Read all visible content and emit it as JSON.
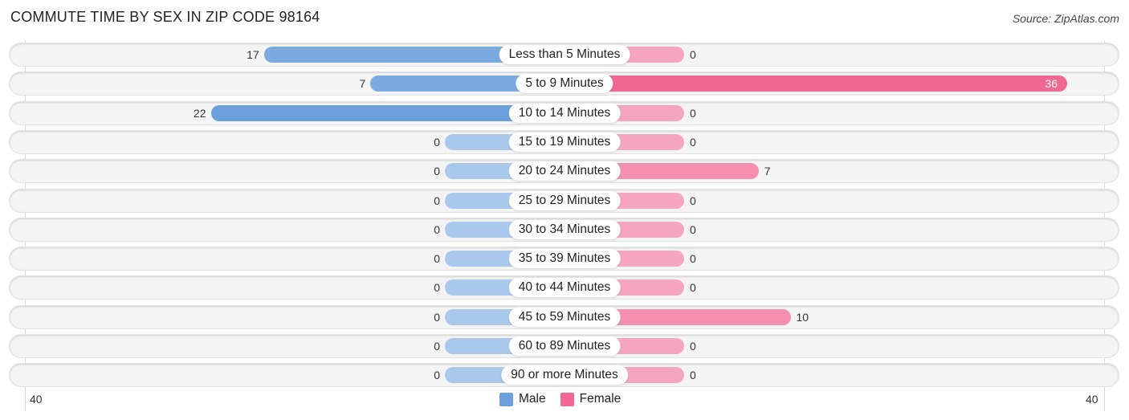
{
  "chart_data": {
    "type": "bar",
    "orientation": "horizontal-diverging",
    "title": "COMMUTE TIME BY SEX IN ZIP CODE 98164",
    "source": "Source: ZipAtlas.com",
    "categories": [
      "Less than 5 Minutes",
      "5 to 9 Minutes",
      "10 to 14 Minutes",
      "15 to 19 Minutes",
      "20 to 24 Minutes",
      "25 to 29 Minutes",
      "30 to 34 Minutes",
      "35 to 39 Minutes",
      "40 to 44 Minutes",
      "45 to 59 Minutes",
      "60 to 89 Minutes",
      "90 or more Minutes"
    ],
    "series": [
      {
        "name": "Male",
        "color": "#6a9fdc",
        "values": [
          17,
          7,
          22,
          0,
          0,
          0,
          0,
          0,
          0,
          0,
          0,
          0
        ]
      },
      {
        "name": "Female",
        "color": "#f06892",
        "values": [
          0,
          36,
          0,
          0,
          7,
          0,
          0,
          0,
          0,
          10,
          0,
          0
        ]
      }
    ],
    "axis_min_label": "40",
    "axis_max_label": "40",
    "xlim": [
      -40,
      40
    ],
    "legend": [
      "Male",
      "Female"
    ],
    "legend_position": "bottom-center"
  }
}
